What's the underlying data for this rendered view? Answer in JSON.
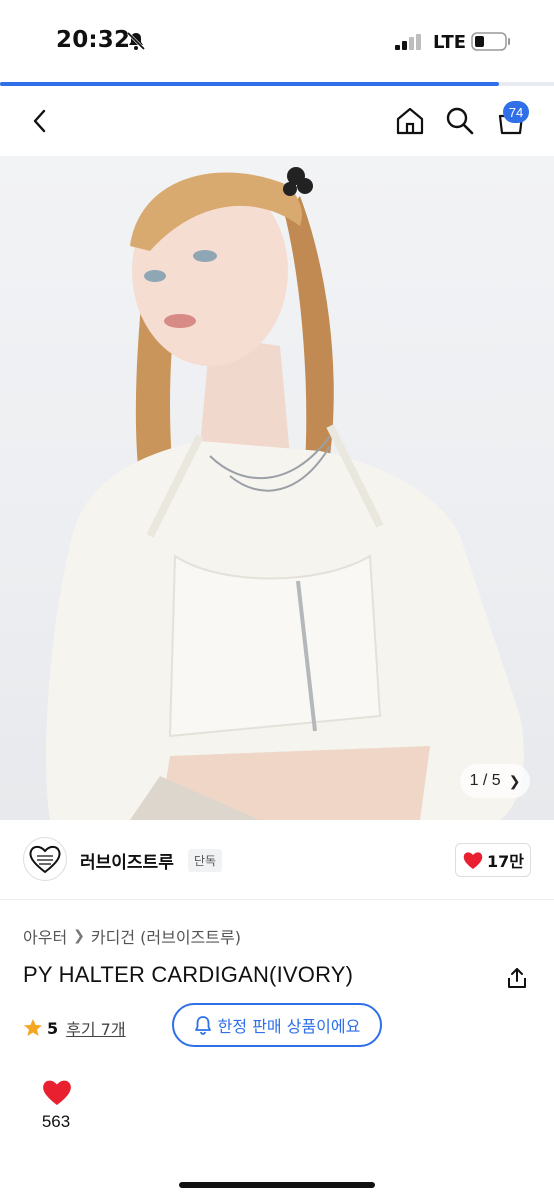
{
  "status": {
    "time": "20:32",
    "network": "LTE"
  },
  "page_progress": 0.9,
  "nav": {
    "cart_count": "74"
  },
  "gallery": {
    "pager": "1 / 5"
  },
  "brand": {
    "name": "러브이즈트루",
    "tag": "단독",
    "likes": "17만"
  },
  "product": {
    "breadcrumb": [
      "아우터",
      "카디건 (러브이즈트루)"
    ],
    "title": "PY HALTER CARDIGAN(IVORY)",
    "rating": "5",
    "reviews": "후기 7개",
    "limited_label": "한정 판매 상품이에요",
    "wish_count": "563"
  },
  "colors": {
    "accent": "#2f6fe8",
    "heart": "#e8202f",
    "star": "#f5a623"
  }
}
